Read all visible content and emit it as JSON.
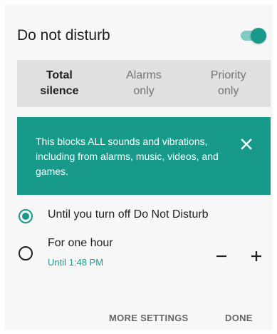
{
  "dialog": {
    "title": "Do not disturb",
    "toggle_state": "on"
  },
  "modes": [
    {
      "label": "Total\nsilence",
      "selected": true
    },
    {
      "label": "Alarms\nonly",
      "selected": false
    },
    {
      "label": "Priority\nonly",
      "selected": false
    }
  ],
  "banner": {
    "text": "This blocks ALL sounds and vibrations, including from alarms, music, videos, and games.",
    "close_icon": "close-icon"
  },
  "duration_options": [
    {
      "label": "Until you turn off Do Not Disturb",
      "checked": true
    },
    {
      "label": "For one hour",
      "sublabel": "Until 1:48 PM",
      "checked": false
    }
  ],
  "stepper": {
    "decrease_icon": "minus-icon",
    "increase_icon": "plus-icon"
  },
  "actions": {
    "more_settings": "MORE SETTINGS",
    "done": "DONE"
  },
  "colors": {
    "accent": "#1a9a8a",
    "banner_bg": "#179a8a",
    "segment_bg": "#e0e0e0",
    "dialog_bg": "#f7f7f7"
  }
}
